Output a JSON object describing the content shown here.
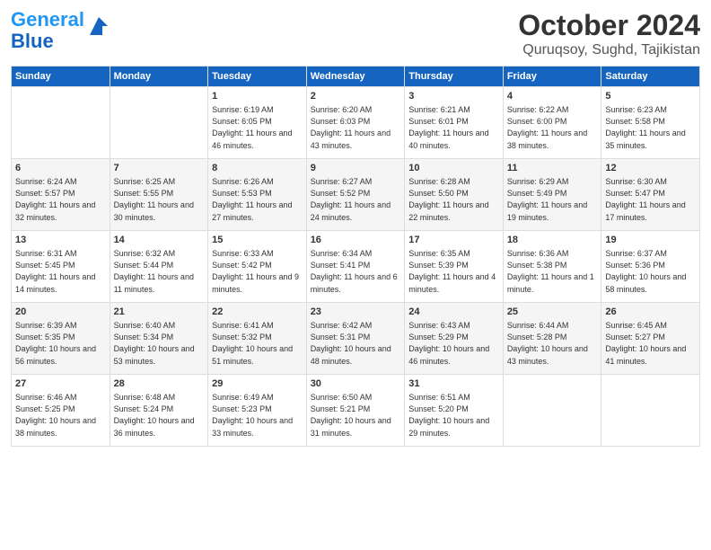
{
  "header": {
    "logo_line1": "General",
    "logo_line2": "Blue",
    "title": "October 2024",
    "location": "Quruqsoy, Sughd, Tajikistan"
  },
  "days_of_week": [
    "Sunday",
    "Monday",
    "Tuesday",
    "Wednesday",
    "Thursday",
    "Friday",
    "Saturday"
  ],
  "weeks": [
    [
      {
        "day": "",
        "content": ""
      },
      {
        "day": "",
        "content": ""
      },
      {
        "day": "1",
        "content": "Sunrise: 6:19 AM\nSunset: 6:05 PM\nDaylight: 11 hours and 46 minutes."
      },
      {
        "day": "2",
        "content": "Sunrise: 6:20 AM\nSunset: 6:03 PM\nDaylight: 11 hours and 43 minutes."
      },
      {
        "day": "3",
        "content": "Sunrise: 6:21 AM\nSunset: 6:01 PM\nDaylight: 11 hours and 40 minutes."
      },
      {
        "day": "4",
        "content": "Sunrise: 6:22 AM\nSunset: 6:00 PM\nDaylight: 11 hours and 38 minutes."
      },
      {
        "day": "5",
        "content": "Sunrise: 6:23 AM\nSunset: 5:58 PM\nDaylight: 11 hours and 35 minutes."
      }
    ],
    [
      {
        "day": "6",
        "content": "Sunrise: 6:24 AM\nSunset: 5:57 PM\nDaylight: 11 hours and 32 minutes."
      },
      {
        "day": "7",
        "content": "Sunrise: 6:25 AM\nSunset: 5:55 PM\nDaylight: 11 hours and 30 minutes."
      },
      {
        "day": "8",
        "content": "Sunrise: 6:26 AM\nSunset: 5:53 PM\nDaylight: 11 hours and 27 minutes."
      },
      {
        "day": "9",
        "content": "Sunrise: 6:27 AM\nSunset: 5:52 PM\nDaylight: 11 hours and 24 minutes."
      },
      {
        "day": "10",
        "content": "Sunrise: 6:28 AM\nSunset: 5:50 PM\nDaylight: 11 hours and 22 minutes."
      },
      {
        "day": "11",
        "content": "Sunrise: 6:29 AM\nSunset: 5:49 PM\nDaylight: 11 hours and 19 minutes."
      },
      {
        "day": "12",
        "content": "Sunrise: 6:30 AM\nSunset: 5:47 PM\nDaylight: 11 hours and 17 minutes."
      }
    ],
    [
      {
        "day": "13",
        "content": "Sunrise: 6:31 AM\nSunset: 5:45 PM\nDaylight: 11 hours and 14 minutes."
      },
      {
        "day": "14",
        "content": "Sunrise: 6:32 AM\nSunset: 5:44 PM\nDaylight: 11 hours and 11 minutes."
      },
      {
        "day": "15",
        "content": "Sunrise: 6:33 AM\nSunset: 5:42 PM\nDaylight: 11 hours and 9 minutes."
      },
      {
        "day": "16",
        "content": "Sunrise: 6:34 AM\nSunset: 5:41 PM\nDaylight: 11 hours and 6 minutes."
      },
      {
        "day": "17",
        "content": "Sunrise: 6:35 AM\nSunset: 5:39 PM\nDaylight: 11 hours and 4 minutes."
      },
      {
        "day": "18",
        "content": "Sunrise: 6:36 AM\nSunset: 5:38 PM\nDaylight: 11 hours and 1 minute."
      },
      {
        "day": "19",
        "content": "Sunrise: 6:37 AM\nSunset: 5:36 PM\nDaylight: 10 hours and 58 minutes."
      }
    ],
    [
      {
        "day": "20",
        "content": "Sunrise: 6:39 AM\nSunset: 5:35 PM\nDaylight: 10 hours and 56 minutes."
      },
      {
        "day": "21",
        "content": "Sunrise: 6:40 AM\nSunset: 5:34 PM\nDaylight: 10 hours and 53 minutes."
      },
      {
        "day": "22",
        "content": "Sunrise: 6:41 AM\nSunset: 5:32 PM\nDaylight: 10 hours and 51 minutes."
      },
      {
        "day": "23",
        "content": "Sunrise: 6:42 AM\nSunset: 5:31 PM\nDaylight: 10 hours and 48 minutes."
      },
      {
        "day": "24",
        "content": "Sunrise: 6:43 AM\nSunset: 5:29 PM\nDaylight: 10 hours and 46 minutes."
      },
      {
        "day": "25",
        "content": "Sunrise: 6:44 AM\nSunset: 5:28 PM\nDaylight: 10 hours and 43 minutes."
      },
      {
        "day": "26",
        "content": "Sunrise: 6:45 AM\nSunset: 5:27 PM\nDaylight: 10 hours and 41 minutes."
      }
    ],
    [
      {
        "day": "27",
        "content": "Sunrise: 6:46 AM\nSunset: 5:25 PM\nDaylight: 10 hours and 38 minutes."
      },
      {
        "day": "28",
        "content": "Sunrise: 6:48 AM\nSunset: 5:24 PM\nDaylight: 10 hours and 36 minutes."
      },
      {
        "day": "29",
        "content": "Sunrise: 6:49 AM\nSunset: 5:23 PM\nDaylight: 10 hours and 33 minutes."
      },
      {
        "day": "30",
        "content": "Sunrise: 6:50 AM\nSunset: 5:21 PM\nDaylight: 10 hours and 31 minutes."
      },
      {
        "day": "31",
        "content": "Sunrise: 6:51 AM\nSunset: 5:20 PM\nDaylight: 10 hours and 29 minutes."
      },
      {
        "day": "",
        "content": ""
      },
      {
        "day": "",
        "content": ""
      }
    ]
  ]
}
